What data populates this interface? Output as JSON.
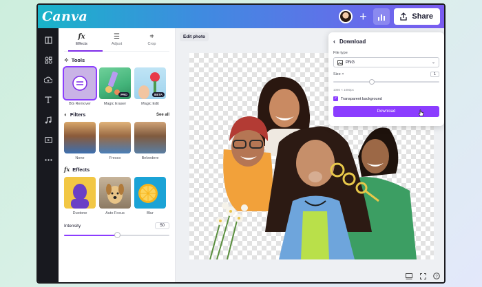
{
  "app": {
    "logo": "Canva"
  },
  "topbar": {
    "share_label": "Share"
  },
  "panel": {
    "tabs": [
      {
        "label": "Effects",
        "glyph": "fx"
      },
      {
        "label": "Adjust",
        "glyph": "☰"
      },
      {
        "label": "Crop",
        "glyph": "⌗"
      }
    ],
    "tools": {
      "title": "Tools",
      "items": [
        {
          "label": "BG Remover",
          "badge": ""
        },
        {
          "label": "Magic Eraser",
          "badge": "PRO"
        },
        {
          "label": "Magic Edit",
          "badge": "BETA"
        }
      ]
    },
    "filters": {
      "title": "Filters",
      "see_all": "See all",
      "items": [
        {
          "label": "None"
        },
        {
          "label": "Fresco"
        },
        {
          "label": "Belvedere"
        }
      ]
    },
    "effects": {
      "title": "Effects",
      "items": [
        {
          "label": "Duotone"
        },
        {
          "label": "Auto Focus"
        },
        {
          "label": "Blur"
        }
      ]
    },
    "intensity": {
      "label": "Intensity",
      "value": "50",
      "fraction": 0.5
    }
  },
  "workspace": {
    "edit_photo_label": "Edit photo"
  },
  "download": {
    "title": "Download",
    "file_type_label": "File type",
    "file_type_value": "PNG",
    "size_label": "Size ×",
    "size_value": "1",
    "dimensions": "1080 × 1080px",
    "transparent_label": "Transparent background",
    "transparent_checked": true,
    "button_label": "Download"
  },
  "colors": {
    "accent": "#8b3dff",
    "rail": "#18191f"
  }
}
